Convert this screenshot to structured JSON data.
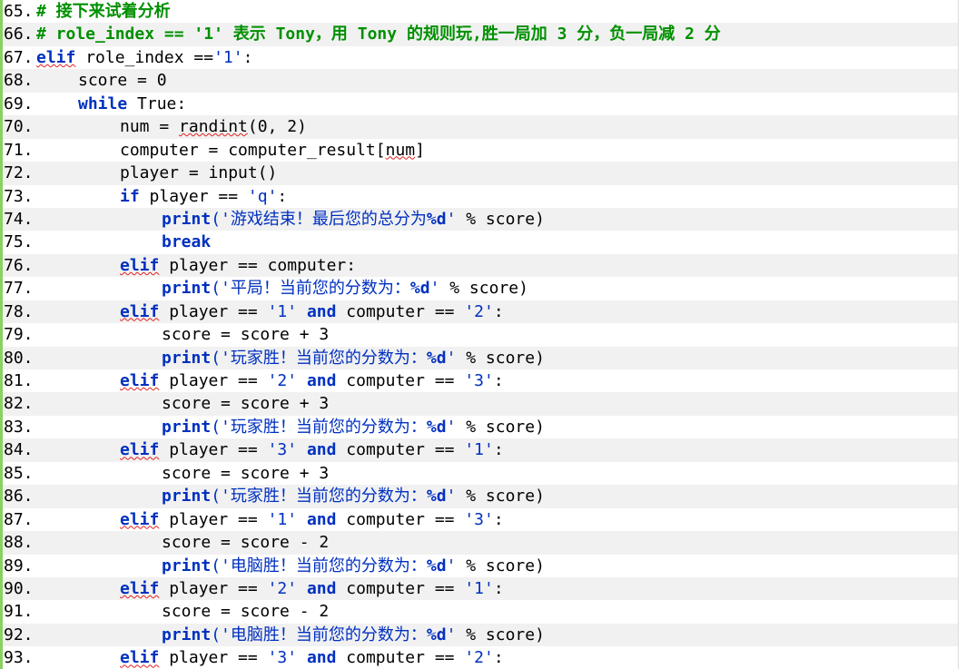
{
  "editor": {
    "lines": [
      {
        "n": "65.",
        "parts": [
          {
            "c": "cm",
            "t": "# 接下来试着分析"
          }
        ]
      },
      {
        "n": "66.",
        "parts": [
          {
            "c": "cm",
            "t": "# role_index == '1' 表示 Tony，用 Tony 的规则玩,胜一局加 3 分，负一局减 2 分"
          }
        ]
      },
      {
        "n": "67.",
        "parts": [
          {
            "c": "kw wavy",
            "t": "elif"
          },
          {
            "c": "",
            "t": " role_index =="
          },
          {
            "c": "str",
            "t": "'1'"
          },
          {
            "c": "",
            "t": ":"
          }
        ]
      },
      {
        "n": "68.",
        "indent": 1,
        "parts": [
          {
            "c": "",
            "t": "score = 0"
          }
        ]
      },
      {
        "n": "69.",
        "indent": 1,
        "parts": [
          {
            "c": "kw",
            "t": "while"
          },
          {
            "c": "",
            "t": " True:"
          }
        ]
      },
      {
        "n": "70.",
        "indent": 2,
        "parts": [
          {
            "c": "",
            "t": "num = "
          },
          {
            "c": "wavy",
            "t": "randint"
          },
          {
            "c": "",
            "t": "(0, 2)"
          }
        ]
      },
      {
        "n": "71.",
        "indent": 2,
        "parts": [
          {
            "c": "",
            "t": "computer = computer_result["
          },
          {
            "c": "wavy",
            "t": "num"
          },
          {
            "c": "",
            "t": "]"
          }
        ]
      },
      {
        "n": "72.",
        "indent": 2,
        "parts": [
          {
            "c": "",
            "t": "player = input()"
          }
        ]
      },
      {
        "n": "73.",
        "indent": 2,
        "parts": [
          {
            "c": "kw",
            "t": "if"
          },
          {
            "c": "",
            "t": " player == "
          },
          {
            "c": "str",
            "t": "'q'"
          },
          {
            "c": "",
            "t": ":"
          }
        ]
      },
      {
        "n": "74.",
        "indent": 3,
        "parts": [
          {
            "c": "kw",
            "t": "print"
          },
          {
            "c": "str",
            "t": "('游戏结束！最后您的总分为"
          },
          {
            "c": "kw",
            "t": "%d"
          },
          {
            "c": "str",
            "t": "'"
          },
          {
            "c": "",
            "t": " % score)"
          }
        ]
      },
      {
        "n": "75.",
        "indent": 3,
        "parts": [
          {
            "c": "kw",
            "t": "break"
          }
        ]
      },
      {
        "n": "76.",
        "indent": 2,
        "parts": [
          {
            "c": "kw wavy",
            "t": "elif"
          },
          {
            "c": "",
            "t": " player == computer:"
          }
        ]
      },
      {
        "n": "77.",
        "indent": 3,
        "parts": [
          {
            "c": "kw",
            "t": "print"
          },
          {
            "c": "str",
            "t": "('平局！当前您的分数为："
          },
          {
            "c": "kw",
            "t": "%d"
          },
          {
            "c": "str",
            "t": "'"
          },
          {
            "c": "",
            "t": " % score)"
          }
        ]
      },
      {
        "n": "78.",
        "indent": 2,
        "parts": [
          {
            "c": "kw wavy",
            "t": "elif"
          },
          {
            "c": "",
            "t": " player == "
          },
          {
            "c": "str",
            "t": "'1'"
          },
          {
            "c": "",
            "t": " "
          },
          {
            "c": "kw",
            "t": "and"
          },
          {
            "c": "",
            "t": " computer == "
          },
          {
            "c": "str",
            "t": "'2'"
          },
          {
            "c": "",
            "t": ":"
          }
        ]
      },
      {
        "n": "79.",
        "indent": 3,
        "parts": [
          {
            "c": "",
            "t": "score = score + 3"
          }
        ]
      },
      {
        "n": "80.",
        "indent": 3,
        "parts": [
          {
            "c": "kw",
            "t": "print"
          },
          {
            "c": "str",
            "t": "('玩家胜！当前您的分数为："
          },
          {
            "c": "kw",
            "t": "%d"
          },
          {
            "c": "str",
            "t": "'"
          },
          {
            "c": "",
            "t": " % score)"
          }
        ]
      },
      {
        "n": "81.",
        "indent": 2,
        "parts": [
          {
            "c": "kw wavy",
            "t": "elif"
          },
          {
            "c": "",
            "t": " player == "
          },
          {
            "c": "str",
            "t": "'2'"
          },
          {
            "c": "",
            "t": " "
          },
          {
            "c": "kw",
            "t": "and"
          },
          {
            "c": "",
            "t": " computer == "
          },
          {
            "c": "str",
            "t": "'3'"
          },
          {
            "c": "",
            "t": ":"
          }
        ]
      },
      {
        "n": "82.",
        "indent": 3,
        "parts": [
          {
            "c": "",
            "t": "score = score + 3"
          }
        ]
      },
      {
        "n": "83.",
        "indent": 3,
        "parts": [
          {
            "c": "kw",
            "t": "print"
          },
          {
            "c": "str",
            "t": "('玩家胜！当前您的分数为："
          },
          {
            "c": "kw",
            "t": "%d"
          },
          {
            "c": "str",
            "t": "'"
          },
          {
            "c": "",
            "t": " % score)"
          }
        ]
      },
      {
        "n": "84.",
        "indent": 2,
        "parts": [
          {
            "c": "kw wavy",
            "t": "elif"
          },
          {
            "c": "",
            "t": " player == "
          },
          {
            "c": "str",
            "t": "'3'"
          },
          {
            "c": "",
            "t": " "
          },
          {
            "c": "kw",
            "t": "and"
          },
          {
            "c": "",
            "t": " computer == "
          },
          {
            "c": "str",
            "t": "'1'"
          },
          {
            "c": "",
            "t": ":"
          }
        ]
      },
      {
        "n": "85.",
        "indent": 3,
        "parts": [
          {
            "c": "",
            "t": "score = score + 3"
          }
        ]
      },
      {
        "n": "86.",
        "indent": 3,
        "parts": [
          {
            "c": "kw",
            "t": "print"
          },
          {
            "c": "str",
            "t": "('玩家胜！当前您的分数为："
          },
          {
            "c": "kw",
            "t": "%d"
          },
          {
            "c": "str",
            "t": "'"
          },
          {
            "c": "",
            "t": " % score)"
          }
        ]
      },
      {
        "n": "87.",
        "indent": 2,
        "parts": [
          {
            "c": "kw wavy",
            "t": "elif"
          },
          {
            "c": "",
            "t": " player == "
          },
          {
            "c": "str",
            "t": "'1'"
          },
          {
            "c": "",
            "t": " "
          },
          {
            "c": "kw",
            "t": "and"
          },
          {
            "c": "",
            "t": " computer == "
          },
          {
            "c": "str",
            "t": "'3'"
          },
          {
            "c": "",
            "t": ":"
          }
        ]
      },
      {
        "n": "88.",
        "indent": 3,
        "parts": [
          {
            "c": "",
            "t": "score = score - 2"
          }
        ]
      },
      {
        "n": "89.",
        "indent": 3,
        "parts": [
          {
            "c": "kw",
            "t": "print"
          },
          {
            "c": "str",
            "t": "('电脑胜！当前您的分数为："
          },
          {
            "c": "kw",
            "t": "%d"
          },
          {
            "c": "str",
            "t": "'"
          },
          {
            "c": "",
            "t": " % score)"
          }
        ]
      },
      {
        "n": "90.",
        "indent": 2,
        "parts": [
          {
            "c": "kw wavy",
            "t": "elif"
          },
          {
            "c": "",
            "t": " player == "
          },
          {
            "c": "str",
            "t": "'2'"
          },
          {
            "c": "",
            "t": " "
          },
          {
            "c": "kw",
            "t": "and"
          },
          {
            "c": "",
            "t": " computer == "
          },
          {
            "c": "str",
            "t": "'1'"
          },
          {
            "c": "",
            "t": ":"
          }
        ]
      },
      {
        "n": "91.",
        "indent": 3,
        "parts": [
          {
            "c": "",
            "t": "score = score - 2"
          }
        ]
      },
      {
        "n": "92.",
        "indent": 3,
        "parts": [
          {
            "c": "kw",
            "t": "print"
          },
          {
            "c": "str",
            "t": "('电脑胜！当前您的分数为："
          },
          {
            "c": "kw",
            "t": "%d"
          },
          {
            "c": "str",
            "t": "'"
          },
          {
            "c": "",
            "t": " % score)"
          }
        ]
      },
      {
        "n": "93.",
        "indent": 2,
        "parts": [
          {
            "c": "kw wavy",
            "t": "elif"
          },
          {
            "c": "",
            "t": " player == "
          },
          {
            "c": "str",
            "t": "'3'"
          },
          {
            "c": "",
            "t": " "
          },
          {
            "c": "kw",
            "t": "and"
          },
          {
            "c": "",
            "t": " computer == "
          },
          {
            "c": "str",
            "t": "'2'"
          },
          {
            "c": "",
            "t": ":"
          }
        ]
      }
    ]
  },
  "colors": {
    "comment": "#009000",
    "keyword": "#0030c0",
    "string": "#0030c0",
    "gutter_bar": "#8ad15f",
    "alt_row": "#f1f1f1",
    "squiggle": "#e02020"
  }
}
